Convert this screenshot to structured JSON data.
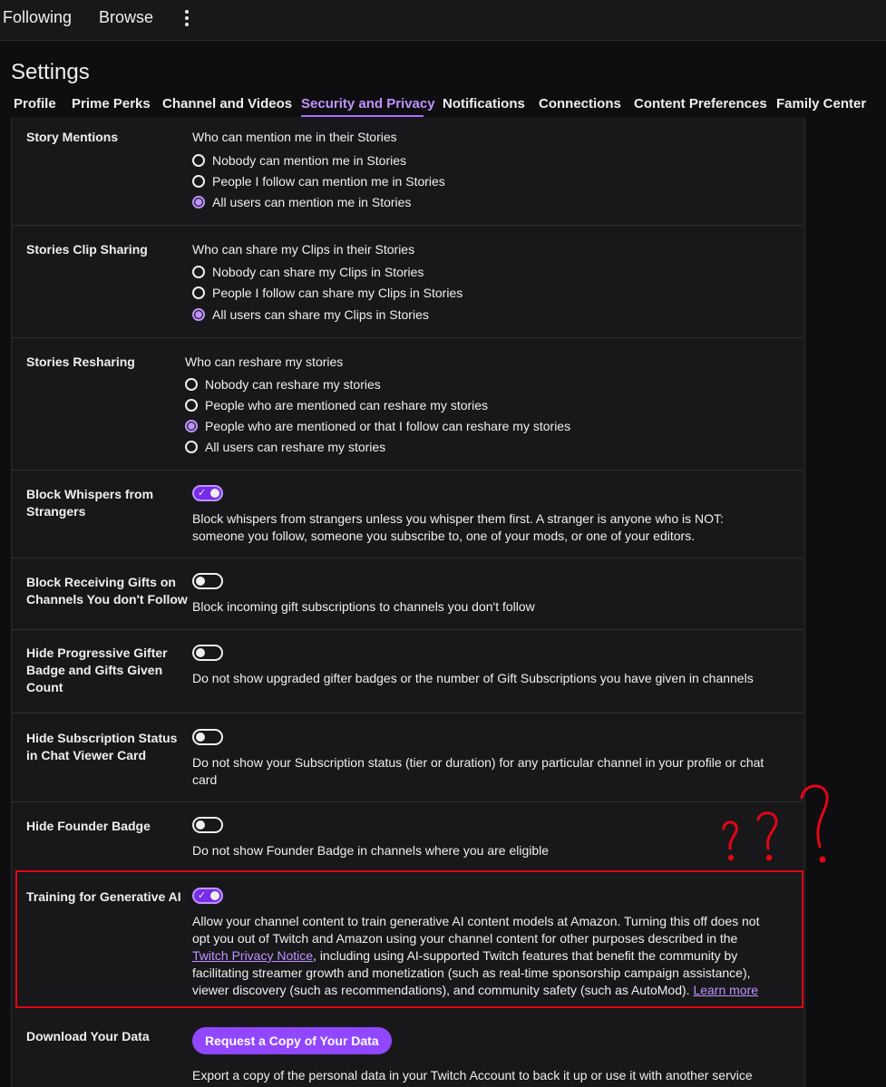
{
  "topbar": {
    "following": "Following",
    "browse": "Browse"
  },
  "page_title": "Settings",
  "tabs": [
    {
      "label": "Profile"
    },
    {
      "label": "Prime Perks"
    },
    {
      "label": "Channel and Videos"
    },
    {
      "label": "Security and Privacy",
      "active": true
    },
    {
      "label": "Notifications"
    },
    {
      "label": "Connections"
    },
    {
      "label": "Content Preferences"
    },
    {
      "label": "Family Center"
    }
  ],
  "story_mentions": {
    "label": "Story Mentions",
    "question": "Who can mention me in their Stories",
    "options": [
      "Nobody can mention me in Stories",
      "People I follow can mention me in Stories",
      "All users can mention me in Stories"
    ],
    "selected": 2
  },
  "clip_sharing": {
    "label": "Stories Clip Sharing",
    "question": "Who can share my Clips in their Stories",
    "options": [
      "Nobody can share my Clips in Stories",
      "People I follow can share my Clips in Stories",
      "All users can share my Clips in Stories"
    ],
    "selected": 2
  },
  "resharing": {
    "label": "Stories Resharing",
    "question": "Who can reshare my stories",
    "options": [
      "Nobody can reshare my stories",
      "People who are mentioned can reshare my stories",
      "People who are mentioned or that I follow can reshare my stories",
      "All users can reshare my stories"
    ],
    "selected": 2
  },
  "block_whispers": {
    "label_l1": "Block Whispers from",
    "label_l2": "Strangers",
    "enabled": true,
    "desc_l1": "Block whispers from strangers unless you whisper them first. A stranger is anyone who is NOT:",
    "desc_l2": "someone you follow, someone you subscribe to, one of your mods, or one of your editors."
  },
  "block_gifts": {
    "label_l1": "Block Receiving Gifts on",
    "label_l2": "Channels You don't Follow",
    "enabled": false,
    "desc": "Block incoming gift subscriptions to channels you don't follow"
  },
  "hide_gifter": {
    "label_l1": "Hide Progressive Gifter",
    "label_l2": "Badge and Gifts Given",
    "label_l3": "Count",
    "enabled": false,
    "desc": "Do not show upgraded gifter badges or the number of Gift Subscriptions you have given in channels"
  },
  "hide_sub_status": {
    "label_l1": "Hide Subscription Status",
    "label_l2": "in Chat Viewer Card",
    "enabled": false,
    "desc_l1": "Do not show your Subscription status (tier or duration) for any particular channel in your profile or chat",
    "desc_l2": "card"
  },
  "hide_founder": {
    "label": "Hide Founder Badge",
    "enabled": false,
    "desc": "Do not show Founder Badge in channels where you are eligible"
  },
  "gen_ai": {
    "label": "Training for Generative AI",
    "enabled": true,
    "desc_l1": "Allow your channel content to train generative AI content models at Amazon. Turning this off does not",
    "desc_l2": "opt you out of Twitch and Amazon using your channel content for other purposes described in the",
    "desc_l3_link": "Twitch Privacy Notice",
    "desc_l3_rest": ", including using AI-supported Twitch features that benefit the community by",
    "desc_l4": "facilitating streamer growth and monetization (such as real-time sponsorship campaign assistance),",
    "desc_l5": "viewer discovery (such as recommendations), and community safety (such as AutoMod).",
    "learn_more": "Learn more"
  },
  "download": {
    "label": "Download Your Data",
    "button": "Request a Copy of Your Data",
    "desc": "Export a copy of the personal data in your Twitch Account to back it up or use it with another service"
  },
  "colors": {
    "accent": "#bf94ff",
    "button": "#9147ff",
    "annotation": "#e30613"
  }
}
